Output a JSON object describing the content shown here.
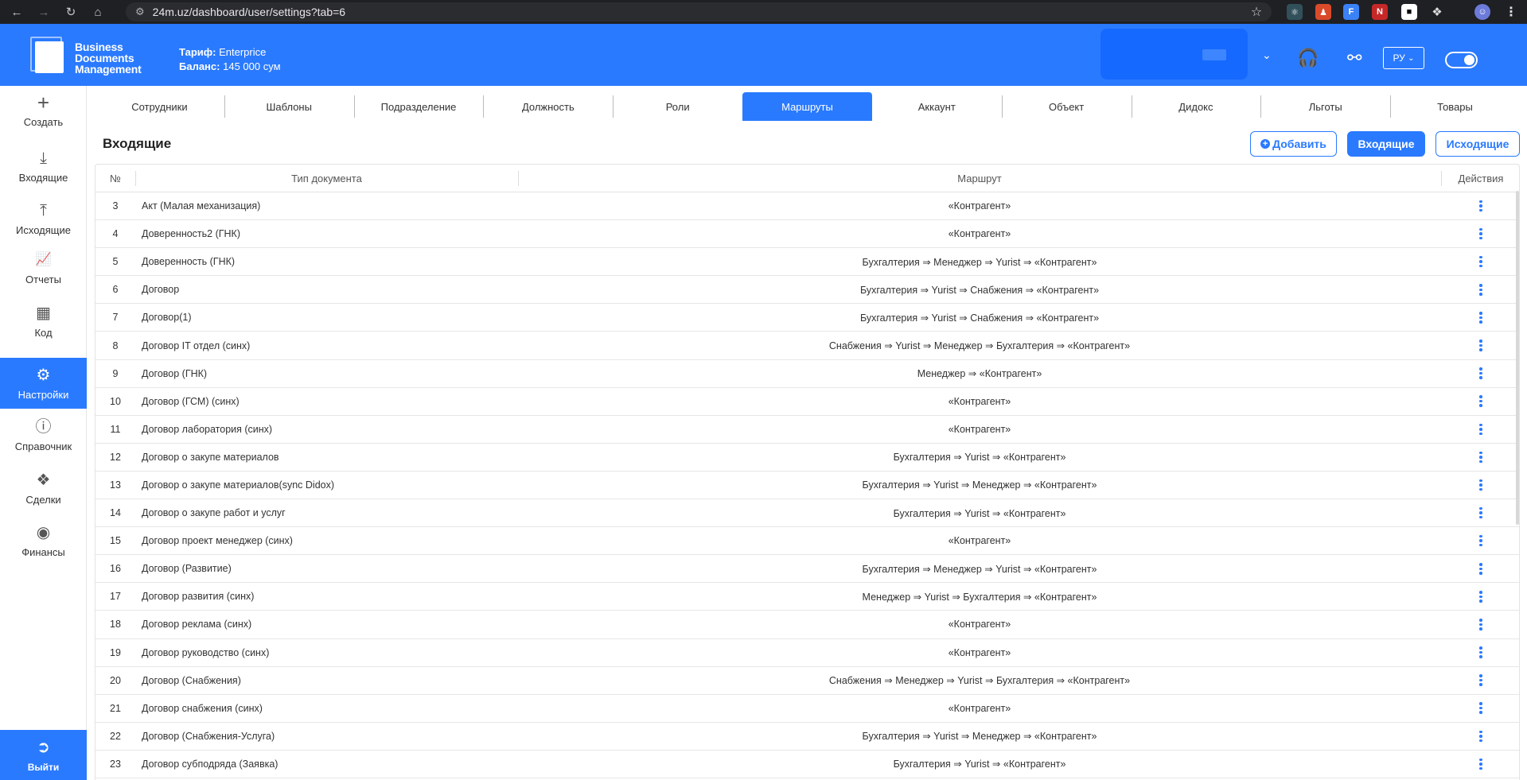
{
  "browser": {
    "url": "24m.uz/dashboard/user/settings?tab=6"
  },
  "header": {
    "brand_line1": "Business",
    "brand_line2": "Documents",
    "brand_line3": "Management",
    "tariff_label": "Тариф:",
    "tariff_value": "Enterprice",
    "balance_label": "Баланс:",
    "balance_value": "145 000 сум",
    "lang": "РУ"
  },
  "sidebar": {
    "items": [
      {
        "label": "Создать",
        "icon": "plus-icon"
      },
      {
        "label": "Входящие",
        "icon": "inbox-download-icon"
      },
      {
        "label": "Исходящие",
        "icon": "outbox-upload-icon"
      },
      {
        "label": "Отчеты",
        "icon": "chart-icon"
      },
      {
        "label": "Код",
        "icon": "grid-plus-icon"
      },
      {
        "label": "Настройки",
        "icon": "gear-icon"
      },
      {
        "label": "Справочник",
        "icon": "info-icon"
      },
      {
        "label": "Сделки",
        "icon": "handshake-icon"
      },
      {
        "label": "Финансы",
        "icon": "dollar-icon"
      }
    ],
    "exit_label": "Выйти"
  },
  "tabs": [
    "Сотрудники",
    "Шаблоны",
    "Подразделение",
    "Должность",
    "Роли",
    "Маршруты",
    "Аккаунт",
    "Объект",
    "Дидокс",
    "Льготы",
    "Товары"
  ],
  "active_tab": "Маршруты",
  "page": {
    "title": "Входящие",
    "add_button": "Добавить",
    "incoming_button": "Входящие",
    "outgoing_button": "Исходящие"
  },
  "table": {
    "headers": {
      "num": "№",
      "type": "Тип документа",
      "route": "Маршрут",
      "actions": "Действия"
    },
    "rows": [
      {
        "num": "3",
        "type": "Акт (Малая механизация)",
        "route": "«Контрагент»"
      },
      {
        "num": "4",
        "type": "Доверенность2 (ГНК)",
        "route": "«Контрагент»"
      },
      {
        "num": "5",
        "type": "Доверенность (ГНК)",
        "route": "Бухгалтерия ⇒ Менеджер ⇒ Yurist ⇒ «Контрагент»"
      },
      {
        "num": "6",
        "type": "Договор",
        "route": "Бухгалтерия ⇒ Yurist ⇒ Снабжения ⇒ «Контрагент»"
      },
      {
        "num": "7",
        "type": "Договор(1)",
        "route": "Бухгалтерия ⇒ Yurist ⇒ Снабжения ⇒ «Контрагент»"
      },
      {
        "num": "8",
        "type": "Договор IT отдел (синх)",
        "route": "Снабжения ⇒ Yurist ⇒ Менеджер ⇒ Бухгалтерия ⇒ «Контрагент»"
      },
      {
        "num": "9",
        "type": "Договор (ГНК)",
        "route": "Менеджер ⇒ «Контрагент»"
      },
      {
        "num": "10",
        "type": "Договор (ГСМ) (синх)",
        "route": "«Контрагент»"
      },
      {
        "num": "11",
        "type": "Договор лаборатория (синх)",
        "route": "«Контрагент»"
      },
      {
        "num": "12",
        "type": "Договор о закупе материалов",
        "route": "Бухгалтерия ⇒ Yurist ⇒ «Контрагент»"
      },
      {
        "num": "13",
        "type": "Договор о закупе материалов(sync Didox)",
        "route": "Бухгалтерия ⇒ Yurist ⇒ Менеджер ⇒ «Контрагент»"
      },
      {
        "num": "14",
        "type": "Договор о закупе работ и услуг",
        "route": "Бухгалтерия ⇒ Yurist ⇒ «Контрагент»"
      },
      {
        "num": "15",
        "type": "Договор проект менеджер (синх)",
        "route": "«Контрагент»"
      },
      {
        "num": "16",
        "type": "Договор (Развитие)",
        "route": "Бухгалтерия ⇒ Менеджер ⇒ Yurist ⇒ «Контрагент»"
      },
      {
        "num": "17",
        "type": "Договор развития (синх)",
        "route": "Менеджер ⇒ Yurist ⇒ Бухгалтерия ⇒ «Контрагент»"
      },
      {
        "num": "18",
        "type": "Договор реклама (синх)",
        "route": "«Контрагент»"
      },
      {
        "num": "19",
        "type": "Договор руководство (синх)",
        "route": "«Контрагент»"
      },
      {
        "num": "20",
        "type": "Договор (Снабжения)",
        "route": "Снабжения ⇒ Менеджер ⇒ Yurist ⇒ Бухгалтерия ⇒ «Контрагент»"
      },
      {
        "num": "21",
        "type": "Договор снабжения (синх)",
        "route": "«Контрагент»"
      },
      {
        "num": "22",
        "type": "Договор (Снабжения-Услуга)",
        "route": "Бухгалтерия ⇒ Yurist ⇒ Менеджер ⇒ «Контрагент»"
      },
      {
        "num": "23",
        "type": "Договор субподряда (Заявка)",
        "route": "Бухгалтерия ⇒ Yurist ⇒ «Контрагент»"
      }
    ]
  },
  "colors": {
    "primary": "#2a7aff",
    "chrome": "#1f2024"
  }
}
